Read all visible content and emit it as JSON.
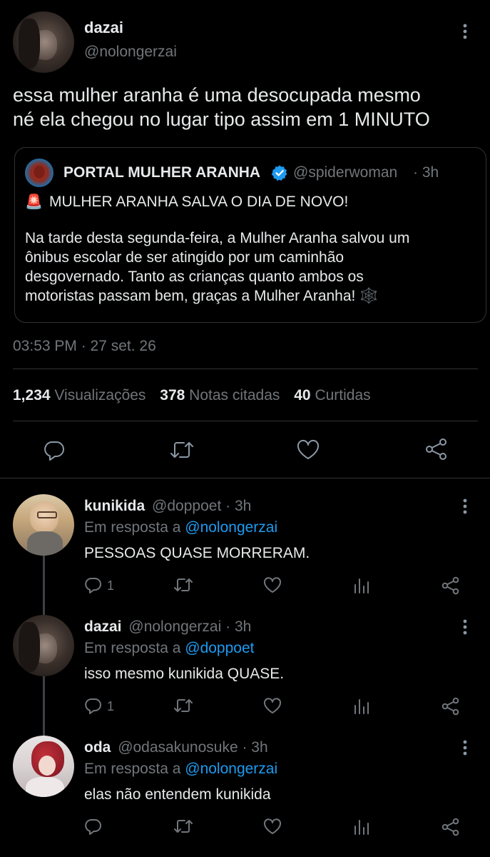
{
  "main_tweet": {
    "display_name": "dazai",
    "handle": "@nolongerzai",
    "text_line1": "essa mulher aranha é uma desocupada mesmo",
    "text_line2": "né ela chegou no lugar tipo assim em 1 MINUTO",
    "quote": {
      "display_name": "PORTAL MULHER ARANHA",
      "handle": "@spiderwoman",
      "time": "· 3h",
      "siren": "🚨",
      "headline": "MULHER ARANHA SALVA O DIA DE NOVO!",
      "body_line1": "Na tarde desta segunda-feira, a Mulher Aranha salvou um",
      "body_line2": "ônibus escolar de ser atingido por um caminhão",
      "body_line3": "desgovernado. Tanto as crianças quanto ambos os",
      "body_line4": "motoristas passam bem, graças a Mulher Aranha! 🕸️"
    },
    "timestamp": "03:53 PM · 27 set. 26",
    "stats": {
      "views_count": "1,234",
      "views_label": "Visualizações",
      "quotes_count": "378",
      "quotes_label": "Notas citadas",
      "likes_count": "40",
      "likes_label": "Curtidas"
    }
  },
  "replies": [
    {
      "display_name": "kunikida",
      "handle": "@doppoet",
      "time": "· 3h",
      "reply_prefix": "Em resposta a",
      "reply_to": "@nolongerzai",
      "text": "PESSOAS QUASE MORRERAM.",
      "reply_count": "1"
    },
    {
      "display_name": "dazai",
      "handle": "@nolongerzai",
      "time": "· 3h",
      "reply_prefix": "Em resposta a",
      "reply_to": "@doppoet",
      "text": "isso mesmo kunikida QUASE.",
      "reply_count": "1"
    },
    {
      "display_name": "oda",
      "handle": "@odasakunosuke",
      "time": "· 3h",
      "reply_prefix": "Em resposta a",
      "reply_to": "@nolongerzai",
      "text": "elas não entendem kunikida",
      "reply_count": ""
    }
  ],
  "icons": {
    "more": "more-vertical-icon",
    "reply": "comment-bubble-icon",
    "retweet": "retweet-icon",
    "like": "heart-icon",
    "share": "share-icon",
    "views": "analytics-icon",
    "verified": "verified-badge-icon"
  },
  "colors": {
    "background": "#000000",
    "text": "#e7e9ea",
    "secondary": "#71767b",
    "link": "#1d9bf0"
  }
}
